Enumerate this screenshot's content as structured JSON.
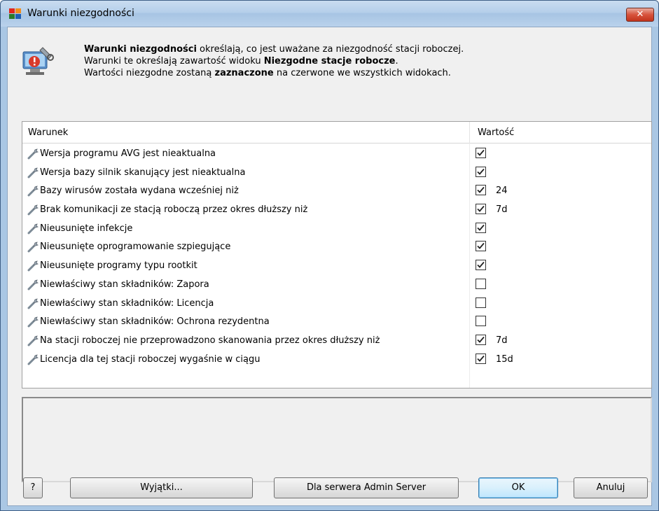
{
  "window": {
    "title": "Warunki niezgodności",
    "close_label": "✕"
  },
  "info": {
    "line1_bold": "Warunki niezgodności",
    "line1_rest": " określają, co jest uważane za niezgodność stacji roboczej.",
    "line2_start": "Warunki te określają zawartość widoku ",
    "line2_bold": "Niezgodne stacje robocze",
    "line2_end": ".",
    "line3_start": "Wartości niezgodne zostaną ",
    "line3_bold": "zaznaczone",
    "line3_end": " na czerwone we wszystkich widokach."
  },
  "table": {
    "columns": [
      "Warunek",
      "Wartość"
    ],
    "rows": [
      {
        "label": "Wersja programu AVG jest nieaktualna",
        "checked": true,
        "value": ""
      },
      {
        "label": "Wersja bazy silnik skanujący jest nieaktualna",
        "checked": true,
        "value": ""
      },
      {
        "label": "Bazy wirusów została wydana wcześniej niż",
        "checked": true,
        "value": "24"
      },
      {
        "label": "Brak komunikacji ze stacją roboczą przez okres dłuższy niż",
        "checked": true,
        "value": "7d"
      },
      {
        "label": "Nieusunięte infekcje",
        "checked": true,
        "value": ""
      },
      {
        "label": "Nieusunięte oprogramowanie szpiegujące",
        "checked": true,
        "value": ""
      },
      {
        "label": "Nieusunięte programy typu rootkit",
        "checked": true,
        "value": ""
      },
      {
        "label": "Niewłaściwy stan składników: Zapora",
        "checked": false,
        "value": ""
      },
      {
        "label": "Niewłaściwy stan składników: Licencja",
        "checked": false,
        "value": ""
      },
      {
        "label": "Niewłaściwy stan składników: Ochrona rezydentna",
        "checked": false,
        "value": ""
      },
      {
        "label": "Na stacji roboczej nie przeprowadzono skanowania przez okres dłuższy niż",
        "checked": true,
        "value": "7d"
      },
      {
        "label": "Licencja dla tej stacji roboczej wygaśnie w ciągu",
        "checked": true,
        "value": "15d"
      }
    ]
  },
  "buttons": {
    "help": "?",
    "exceptions": "Wyjątki...",
    "admin_server": "Dla serwera Admin Server",
    "ok": "OK",
    "cancel": "Anuluj"
  },
  "icons": {
    "app": "avg-logo-icon",
    "info": "workstation-settings-icon",
    "row": "wrench-icon",
    "check": "checkmark-icon"
  }
}
